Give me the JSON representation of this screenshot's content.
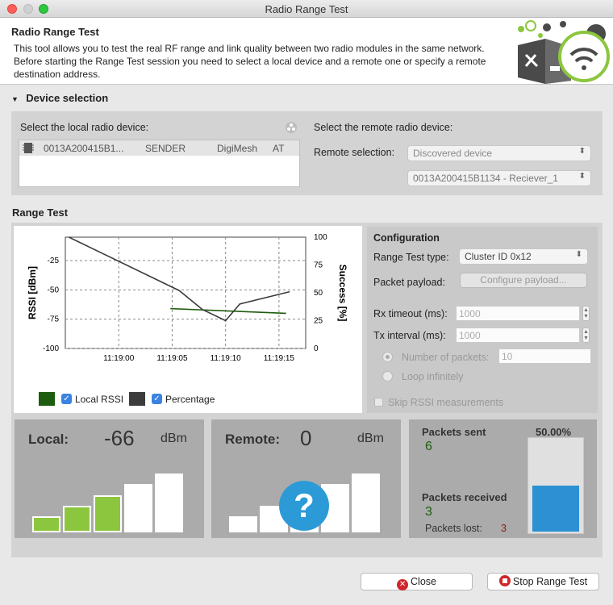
{
  "window": {
    "title": "Radio Range Test"
  },
  "header": {
    "title": "Radio Range Test",
    "description": "This tool allows you to test the real RF range and link quality between two radio modules in the same network. Before starting the Range Test session you need to select a local device and a remote one or specify a remote destination address."
  },
  "device_selection": {
    "title": "Device selection",
    "local_label": "Select the local radio device:",
    "local_device": {
      "address": "0013A200415B1...",
      "role": "SENDER",
      "protocol": "DigiMesh",
      "mode": "AT"
    },
    "remote_label": "Select the remote radio device:",
    "remote_selection_label": "Remote selection:",
    "remote_selection_value": "Discovered device",
    "remote_device_value": "0013A200415B1134 - Reciever_1"
  },
  "range_test": {
    "title": "Range Test",
    "legend": [
      {
        "label": "Local RSSI",
        "color": "#1e5c0f"
      },
      {
        "label": "Percentage",
        "color": "#3c3c3c"
      }
    ]
  },
  "chart_data": {
    "type": "line",
    "x_ticks": [
      "11:19:00",
      "11:19:05",
      "11:19:10",
      "11:19:15"
    ],
    "y_left_label": "RSSI [dBm]",
    "y_left_ticks": [
      "-25",
      "-50",
      "-75",
      "-100"
    ],
    "y_left_lim": [
      -100,
      -5
    ],
    "y_right_label": "Success [%]",
    "y_right_ticks": [
      "100",
      "75",
      "50",
      "25",
      "0"
    ],
    "y_right_lim": [
      0,
      100
    ],
    "series": [
      {
        "name": "Local RSSI",
        "axis": "left",
        "color": "#1e5c0f",
        "points": [
          [
            0.29,
            -66
          ],
          [
            0.94,
            -70
          ]
        ]
      },
      {
        "name": "Percentage",
        "axis": "right",
        "color": "#3c3c3c",
        "points": [
          [
            -0.28,
            100
          ],
          [
            0.34,
            52
          ],
          [
            0.47,
            35
          ],
          [
            0.6,
            25
          ],
          [
            0.68,
            40
          ],
          [
            0.96,
            51
          ]
        ]
      }
    ],
    "grid": true
  },
  "configuration": {
    "title": "Configuration",
    "range_test_type_label": "Range Test type:",
    "range_test_type_value": "Cluster ID 0x12",
    "packet_payload_label": "Packet payload:",
    "configure_payload_button": "Configure payload...",
    "rx_timeout_label": "Rx timeout (ms):",
    "rx_timeout_value": "1000",
    "tx_interval_label": "Tx interval (ms):",
    "tx_interval_value": "1000",
    "num_packets_label": "Number of packets:",
    "num_packets_value": "10",
    "loop_label": "Loop infinitely",
    "skip_rssi_label": "Skip RSSI measurements"
  },
  "local_meter": {
    "label": "Local:",
    "value": "-66",
    "unit": "dBm",
    "level": 3
  },
  "remote_meter": {
    "label": "Remote:",
    "value": "0",
    "unit": "dBm",
    "level": 0
  },
  "packets": {
    "sent_label": "Packets sent",
    "sent_value": "6",
    "received_label": "Packets received",
    "received_value": "3",
    "lost_label": "Packets lost:",
    "lost_value": "3",
    "percentage": "50.00%",
    "success_fraction": 0.5
  },
  "footer": {
    "close_button": "Close",
    "stop_button": "Stop Range Test"
  }
}
